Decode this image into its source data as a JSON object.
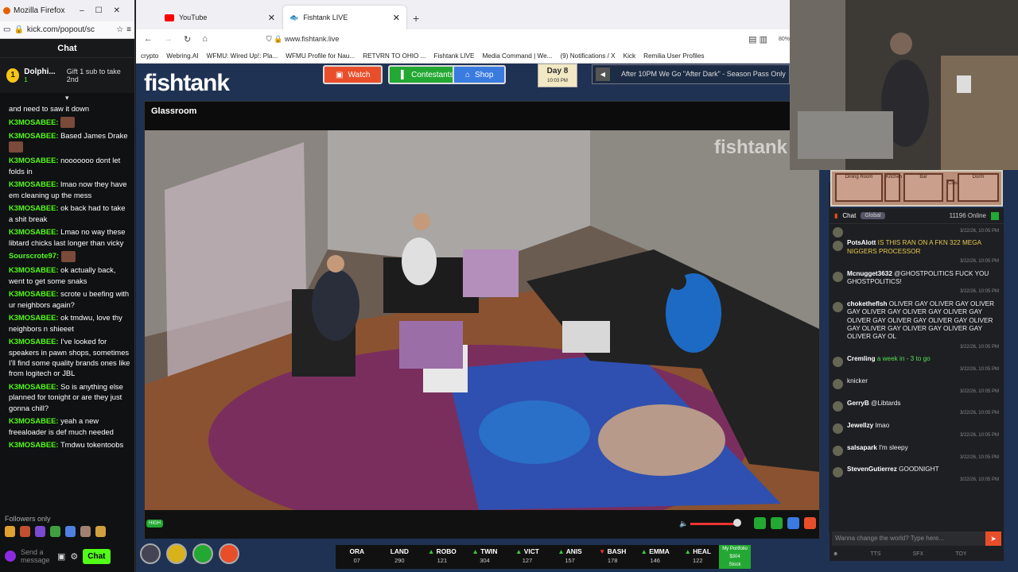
{
  "kick": {
    "window_title": "Mozilla Firefox",
    "url": "kick.com/popout/sc",
    "header": "Chat",
    "pinned": {
      "name": "Dolphi...",
      "count": "1",
      "gift": "Gift 1 sub to take 2nd"
    },
    "messages": [
      {
        "user": "",
        "text": "and need to saw it down"
      },
      {
        "user": "K3MOSABEE:",
        "text": "",
        "emote": true
      },
      {
        "user": "K3MOSABEE:",
        "text": "Based James Drake",
        "emote": true
      },
      {
        "user": "K3MOSABEE:",
        "text": "nooooooo dont let folds in"
      },
      {
        "user": "K3MOSABEE:",
        "text": "lmao now they have em cleaning up the mess"
      },
      {
        "user": "K3MOSABEE:",
        "text": "ok back had to take a shit break"
      },
      {
        "user": "K3MOSABEE:",
        "text": "Lmao no way these libtard chicks last longer than vicky"
      },
      {
        "user": "Sourscrote97:",
        "text": "",
        "emote": true
      },
      {
        "user": "K3MOSABEE:",
        "text": "ok actually back, went to get some snaks"
      },
      {
        "user": "K3MOSABEE:",
        "text": "scrote u beefing with ur neighbors again?"
      },
      {
        "user": "K3MOSABEE:",
        "text": "ok tmdwu, love thy neighbors n shieeet"
      },
      {
        "user": "K3MOSABEE:",
        "text": "I've looked for speakers in pawn shops, sometimes I'll find some quality brands ones like from logitech or JBL"
      },
      {
        "user": "K3MOSABEE:",
        "text": "So is anything else planned for tonight or are they just gonna chill?"
      },
      {
        "user": "K3MOSABEE:",
        "text": "yeah a new freealoader is def much needed"
      },
      {
        "user": "K3MOSABEE:",
        "text": "Tmdwu tokentoobs"
      }
    ],
    "followers_only": "Followers only",
    "send_placeholder": "Send a message",
    "chat_button": "Chat"
  },
  "browser": {
    "tabs": [
      {
        "label": "YouTube",
        "active": false
      },
      {
        "label": "Fishtank LIVE",
        "active": true
      }
    ],
    "url": "www.fishtank.live",
    "bookmarks": [
      "crypto",
      "Webring.AI",
      "WFMU: Wired Up!: Pla...",
      "WFMU Profile for Nau...",
      "RETVRN TO OHIO ...",
      "Fishtank LIVE",
      "Media Command | We...",
      "(9) Notifications / X",
      "Kick",
      "Remilia User Profiles"
    ]
  },
  "fishtank": {
    "logo": "fishtank",
    "nav": {
      "watch": "Watch",
      "contestants": "Contestants",
      "shop": "Shop"
    },
    "day": "Day 8",
    "time": "10:03 PM",
    "ticker": "After 10PM We Go \"After Dark\" - Season Pass Only",
    "room": "Glassroom",
    "watermark": "fishtank",
    "quality": "HIGH",
    "colors": {
      "watch": "#e94e2b",
      "contestants": "#23a833",
      "shop": "#3a7be0",
      "bg": "#1f3253"
    }
  },
  "stocks": [
    {
      "name": "ORA",
      "price": "07",
      "dir": "none"
    },
    {
      "name": "LAND",
      "price": "290",
      "dir": "none"
    },
    {
      "name": "ROBO",
      "price": "121",
      "dir": "up"
    },
    {
      "name": "TWIN",
      "price": "304",
      "dir": "up"
    },
    {
      "name": "VICT",
      "price": "127",
      "dir": "up"
    },
    {
      "name": "ANIS",
      "price": "157",
      "dir": "up"
    },
    {
      "name": "BASH",
      "price": "178",
      "dir": "dn"
    },
    {
      "name": "EMMA",
      "price": "146",
      "dir": "up"
    },
    {
      "name": "HEAL",
      "price": "122",
      "dir": "up"
    }
  ],
  "portfolio": {
    "label": "My Portfolio",
    "value": "$304",
    "button": "Stock"
  },
  "map": {
    "rooms": [
      "Dining Room",
      "Kitchen",
      "Bar",
      "Closet",
      "Dorm"
    ]
  },
  "room_chat": {
    "header": "Chat",
    "scope": "Global",
    "online": "11196 Online",
    "messages": [
      {
        "user": "",
        "text": "",
        "ts": "3/22/26, 10:05 PM"
      },
      {
        "user": "PotsAlott",
        "text": "IS THIS RAN ON A FKN 322 MEGA NIGGERS PROCESSOR",
        "ts": "3/22/26, 10:05 PM",
        "cls": "mention"
      },
      {
        "user": "Mcnugget3632",
        "text": "@GHOSTPOLITICS FUCK YOU GHOSTPOLITICS!",
        "ts": "3/22/26, 10:05 PM"
      },
      {
        "user": "choketheflsh",
        "text": "OLIVER GAY OLIVER GAY OLIVER GAY OLIVER GAY OLIVER GAY OLIVER GAY OLIVER GAY OLIVER GAY OLIVER GAY OLIVER GAY OLIVER GAY OLIVER GAY OLIVER GAY OLIVER GAY OL",
        "ts": "3/22/26, 10:05 PM"
      },
      {
        "user": "Cremling",
        "text": "a week in - 3 to go",
        "ts": "3/22/26, 10:05 PM",
        "cls": "grn"
      },
      {
        "user": "",
        "text": "knicker",
        "ts": "3/22/26, 10:05 PM"
      },
      {
        "user": "GerryB",
        "text": "@Libtards",
        "ts": "3/22/26, 10:05 PM"
      },
      {
        "user": "Jewellzy",
        "text": "lmao",
        "ts": "3/22/26, 10:05 PM"
      },
      {
        "user": "salsapark",
        "text": "I'm sleepy",
        "ts": "3/22/26, 10:05 PM"
      },
      {
        "user": "StevenGutierrez",
        "text": "GOODNIGHT",
        "ts": "3/22/26, 10:05 PM"
      }
    ],
    "input_placeholder": "Wanna change the world? Type here...",
    "bottom": [
      "TTS",
      "SFX",
      "TOY"
    ]
  }
}
